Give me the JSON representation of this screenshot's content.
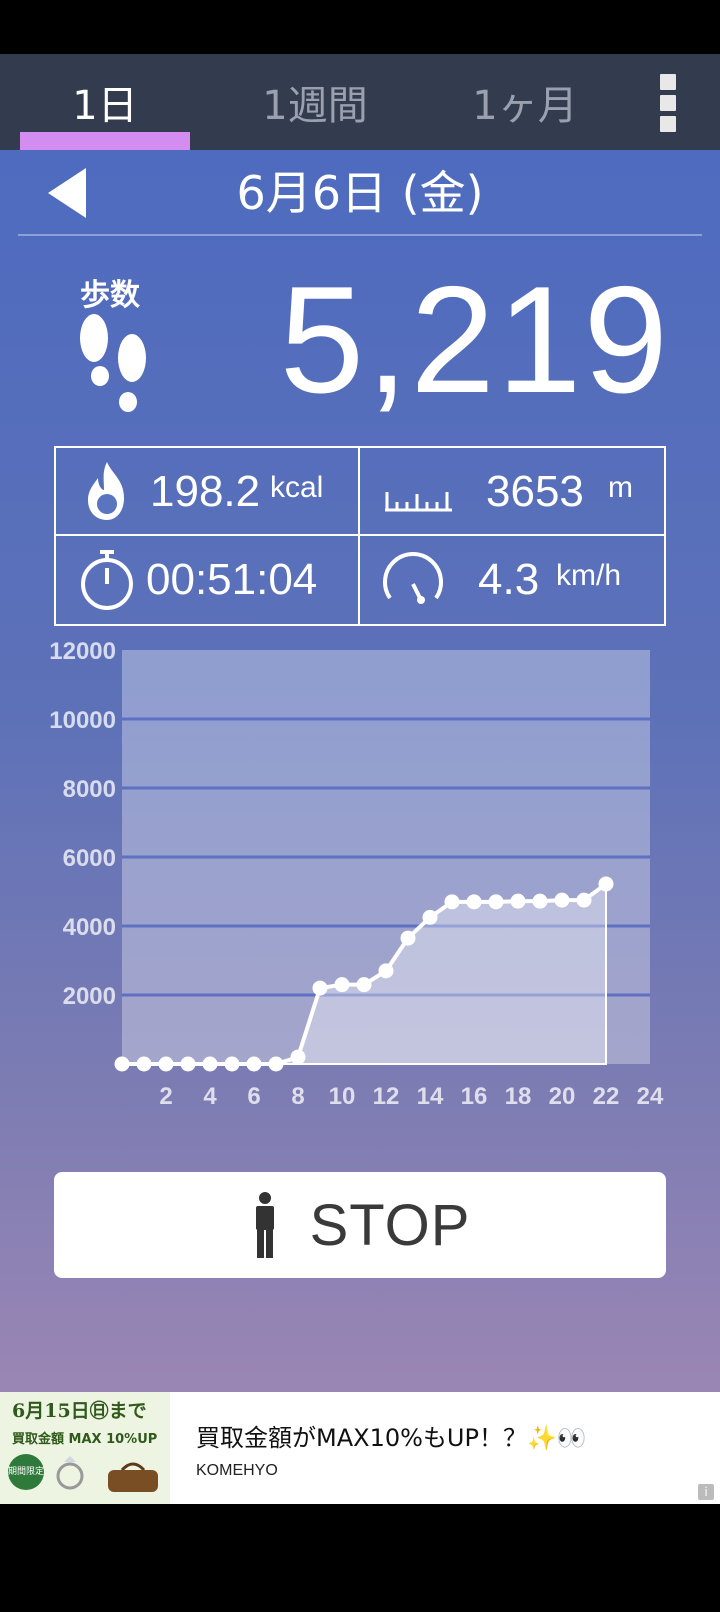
{
  "tabs": [
    {
      "label": "1日",
      "active": true
    },
    {
      "label": "1週間",
      "active": false
    },
    {
      "label": "1ヶ月",
      "active": false
    }
  ],
  "colors": {
    "tabbar_bg": "#333b4f",
    "tab_indicator": "#d38cf0",
    "accent_text": "#ffffff"
  },
  "date": {
    "label": "6月6日 (金)"
  },
  "steps": {
    "label": "歩数",
    "value": "5,219"
  },
  "stats": {
    "calories": {
      "value": "198.2",
      "unit": "kcal",
      "icon": "flame-icon"
    },
    "distance": {
      "value": "3653",
      "unit": "m",
      "icon": "ruler-icon"
    },
    "duration": {
      "value": "00:51:04",
      "icon": "stopwatch-icon"
    },
    "speed": {
      "value": "4.3",
      "unit": "km/h",
      "icon": "speedometer-icon"
    }
  },
  "chart_data": {
    "type": "area",
    "title": "",
    "xlabel": "",
    "ylabel": "",
    "ylim": [
      0,
      12000
    ],
    "xlim": [
      0,
      24
    ],
    "y_ticks": [
      "12000",
      "10000",
      "8000",
      "6000",
      "4000",
      "2000"
    ],
    "x_ticks": [
      "2",
      "4",
      "6",
      "8",
      "10",
      "12",
      "14",
      "16",
      "18",
      "20",
      "22",
      "24"
    ],
    "grid": true,
    "x": [
      0,
      1,
      2,
      3,
      4,
      5,
      6,
      7,
      8,
      9,
      10,
      11,
      12,
      13,
      14,
      15,
      16,
      17,
      18,
      19,
      20,
      21,
      22
    ],
    "values": [
      0,
      0,
      0,
      0,
      0,
      0,
      0,
      0,
      200,
      2200,
      2300,
      2300,
      2700,
      3650,
      4250,
      4700,
      4700,
      4700,
      4720,
      4720,
      4750,
      4750,
      5219
    ]
  },
  "stop_button": {
    "label": "STOP"
  },
  "ad": {
    "image_title": "6月15日㊐まで",
    "image_sub": "買取金額 MAX 10%UP",
    "image_badge": "期間限定",
    "headline": "買取金額がMAX10%もUP！？✨👀",
    "brand": "KOMEHYO",
    "info": "i"
  }
}
